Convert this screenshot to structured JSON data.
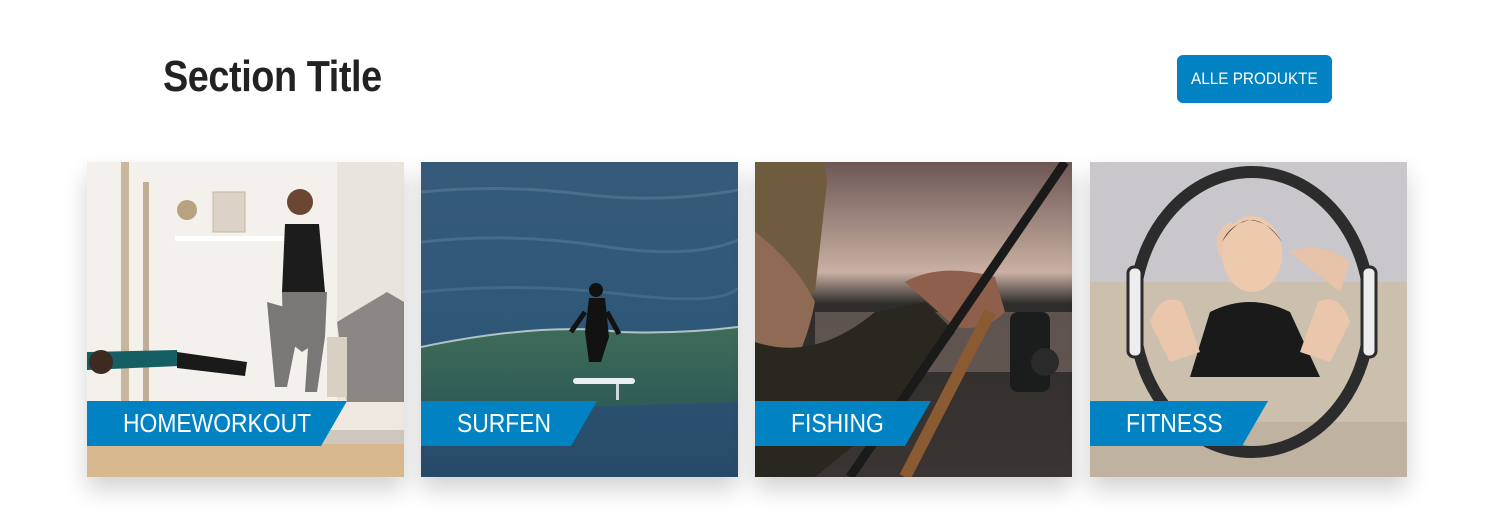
{
  "section": {
    "title": "Section Title",
    "all_button_label": "ALLE PRODUKTE"
  },
  "cards": [
    {
      "label": "HOMEWORKOUT"
    },
    {
      "label": "SURFEN"
    },
    {
      "label": "FISHING"
    },
    {
      "label": "FITNESS"
    }
  ],
  "colors": {
    "accent": "#0082c3",
    "title": "#222222",
    "background": "#ffffff"
  }
}
